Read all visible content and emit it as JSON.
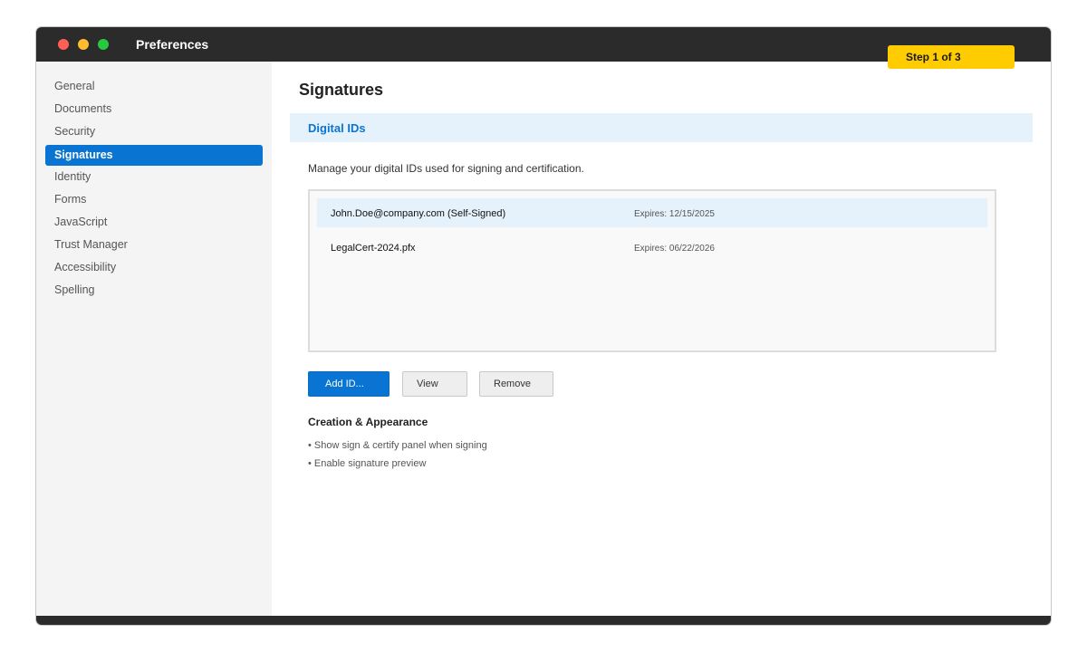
{
  "window": {
    "title": "Preferences",
    "step_badge": "Step 1 of 3"
  },
  "sidebar": {
    "items": [
      {
        "label": "General"
      },
      {
        "label": "Documents"
      },
      {
        "label": "Security"
      },
      {
        "label": "Signatures",
        "active": true
      },
      {
        "label": "Identity"
      },
      {
        "label": "Forms"
      },
      {
        "label": "JavaScript"
      },
      {
        "label": "Trust Manager"
      },
      {
        "label": "Accessibility"
      },
      {
        "label": "Spelling"
      }
    ]
  },
  "main": {
    "title": "Signatures",
    "section_header": "Digital IDs",
    "description": "Manage your digital IDs used for signing and certification.",
    "digital_ids": [
      {
        "name": "John.Doe@company.com (Self-Signed)",
        "expiry": "Expires: 12/15/2025",
        "selected": true
      },
      {
        "name": "LegalCert-2024.pfx",
        "expiry": "Expires: 06/22/2026",
        "selected": false
      }
    ],
    "buttons": {
      "add": "Add ID...",
      "view": "View",
      "remove": "Remove"
    },
    "creation_section": {
      "title": "Creation & Appearance",
      "options": [
        "• Show sign & certify panel when signing",
        "• Enable signature preview"
      ]
    }
  },
  "colors": {
    "accent": "#0a74d2",
    "titlebar": "#2b2b2b",
    "step_badge": "#ffcc00",
    "section_header_bg": "#e6f2fb",
    "sidebar_bg": "#f4f4f4"
  },
  "icons": {
    "window_controls": [
      "close-icon",
      "minimize-icon",
      "zoom-icon"
    ]
  }
}
